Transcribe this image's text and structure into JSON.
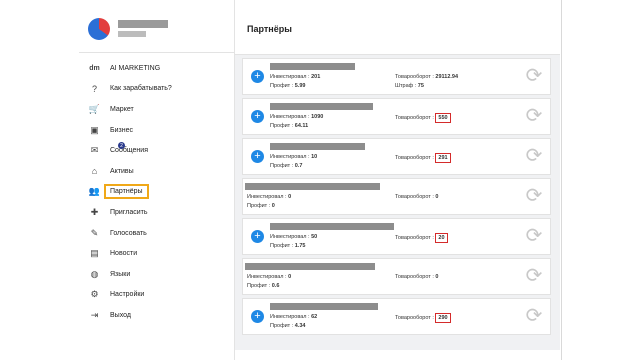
{
  "header": {
    "title": "Партнёры"
  },
  "sidebar": {
    "items": [
      {
        "label": "AI MARKETING",
        "icon": "dm-logo-icon"
      },
      {
        "label": "Как зарабатывать?",
        "icon": "question-icon"
      },
      {
        "label": "Маркет",
        "icon": "cart-icon"
      },
      {
        "label": "Бизнес",
        "icon": "briefcase-icon"
      },
      {
        "label": "Сообщения",
        "icon": "chat-icon",
        "badge": "2"
      },
      {
        "label": "Активы",
        "icon": "bank-icon"
      },
      {
        "label": "Партнёры",
        "icon": "users-icon",
        "active": true
      },
      {
        "label": "Пригласить",
        "icon": "invite-icon"
      },
      {
        "label": "Голосовать",
        "icon": "vote-icon"
      },
      {
        "label": "Новости",
        "icon": "news-icon"
      },
      {
        "label": "Языки",
        "icon": "globe-icon"
      },
      {
        "label": "Настройки",
        "icon": "gear-icon"
      },
      {
        "label": "Выход",
        "icon": "exit-icon"
      }
    ]
  },
  "partners": [
    {
      "invest_label": "Инвестировал :",
      "invest": "201",
      "profit_label": "Профит :",
      "profit": "5.99",
      "turnover_label": "Товарооборот :",
      "turnover": "29112.94",
      "fine_label": "Штраф :",
      "fine": "75",
      "boxed": false
    },
    {
      "invest_label": "Инвестировал :",
      "invest": "1090",
      "profit_label": "Профит :",
      "profit": "64.11",
      "turnover_label": "Товарооборот :",
      "turnover": "550",
      "boxed": true
    },
    {
      "invest_label": "Инвестировал :",
      "invest": "10",
      "profit_label": "Профит :",
      "profit": "0.7",
      "turnover_label": "Товарооборот :",
      "turnover": "291",
      "boxed": true
    },
    {
      "invest_label": "Инвестировал :",
      "invest": "0",
      "profit_label": "Профит :",
      "profit": "0",
      "turnover_label": "Товарооборот :",
      "turnover": "0",
      "boxed": false,
      "noplus": true
    },
    {
      "invest_label": "Инвестировал :",
      "invest": "50",
      "profit_label": "Профит :",
      "profit": "1.75",
      "turnover_label": "Товарооборот :",
      "turnover": "20",
      "boxed": true
    },
    {
      "invest_label": "Инвестировал :",
      "invest": "0",
      "profit_label": "Профит :",
      "profit": "0.6",
      "turnover_label": "Товарооборот :",
      "turnover": "0",
      "boxed": false,
      "noplus": true
    },
    {
      "invest_label": "Инвестировал :",
      "invest": "62",
      "profit_label": "Профит :",
      "profit": "4.34",
      "turnover_label": "Товарооборот :",
      "turnover": "290",
      "boxed": true
    }
  ],
  "colors": {
    "accent": "#1e88e5",
    "highlight_box": "#d42b2b",
    "active_border": "#f0a818"
  }
}
